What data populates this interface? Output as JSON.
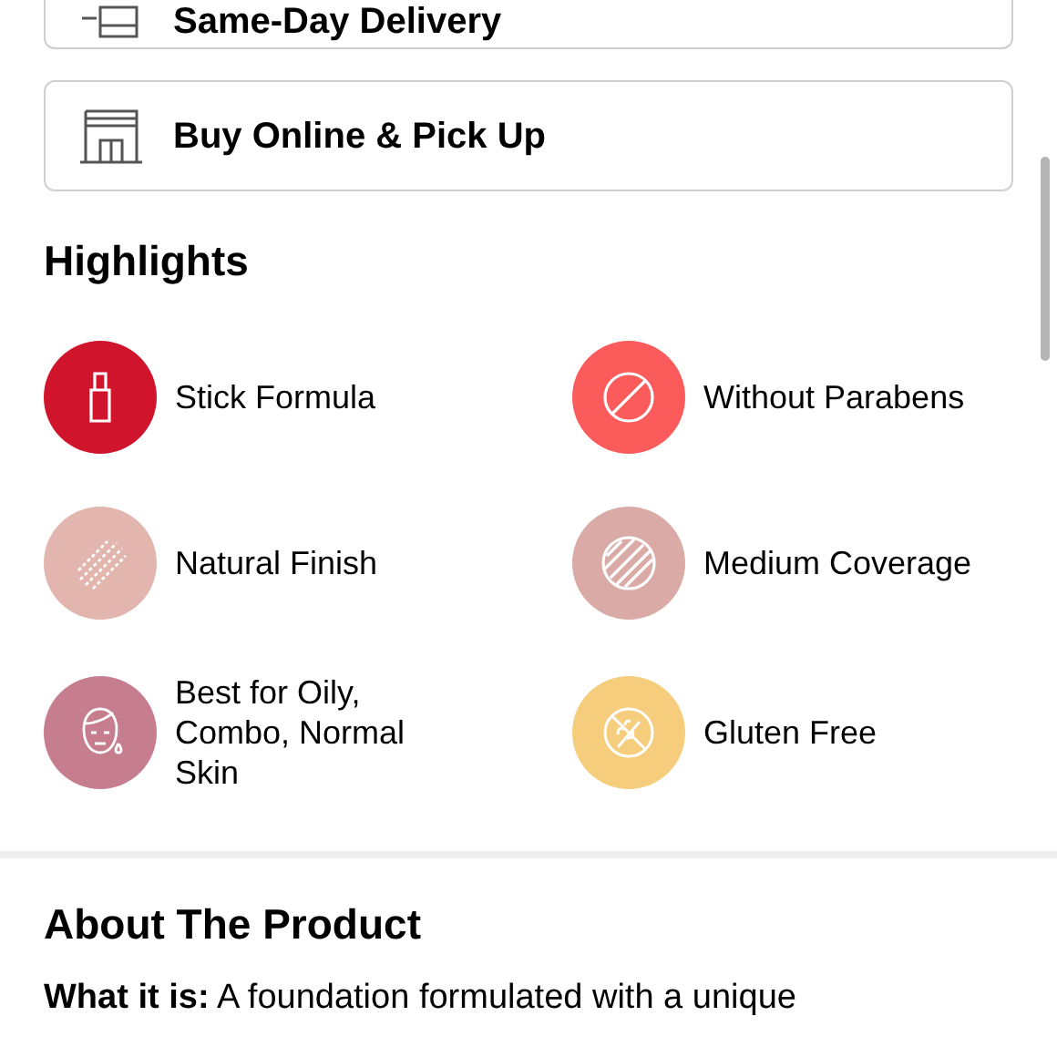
{
  "delivery_options": [
    {
      "kind": "delivery",
      "label": "Same-Day Delivery"
    },
    {
      "kind": "pickup",
      "label": "Buy Online & Pick Up"
    }
  ],
  "highlights": {
    "title": "Highlights",
    "items": [
      {
        "kind": "stick",
        "label": "Stick Formula",
        "color": "#d0142c"
      },
      {
        "kind": "no-parabens",
        "label": "Without Parabens",
        "color": "#fb5b5b"
      },
      {
        "kind": "natural",
        "label": "Natural Finish",
        "color": "#e2b6ae"
      },
      {
        "kind": "medium",
        "label": "Medium Coverage",
        "color": "#d9aaa6"
      },
      {
        "kind": "skin",
        "label": "Best for Oily, Combo, Normal Skin",
        "color": "#c67d8d"
      },
      {
        "kind": "gluten-free",
        "label": "Gluten Free",
        "color": "#f6cd7c"
      }
    ]
  },
  "about": {
    "title": "About The Product",
    "text": "**What it is:** A foundation formulated with a unique"
  }
}
